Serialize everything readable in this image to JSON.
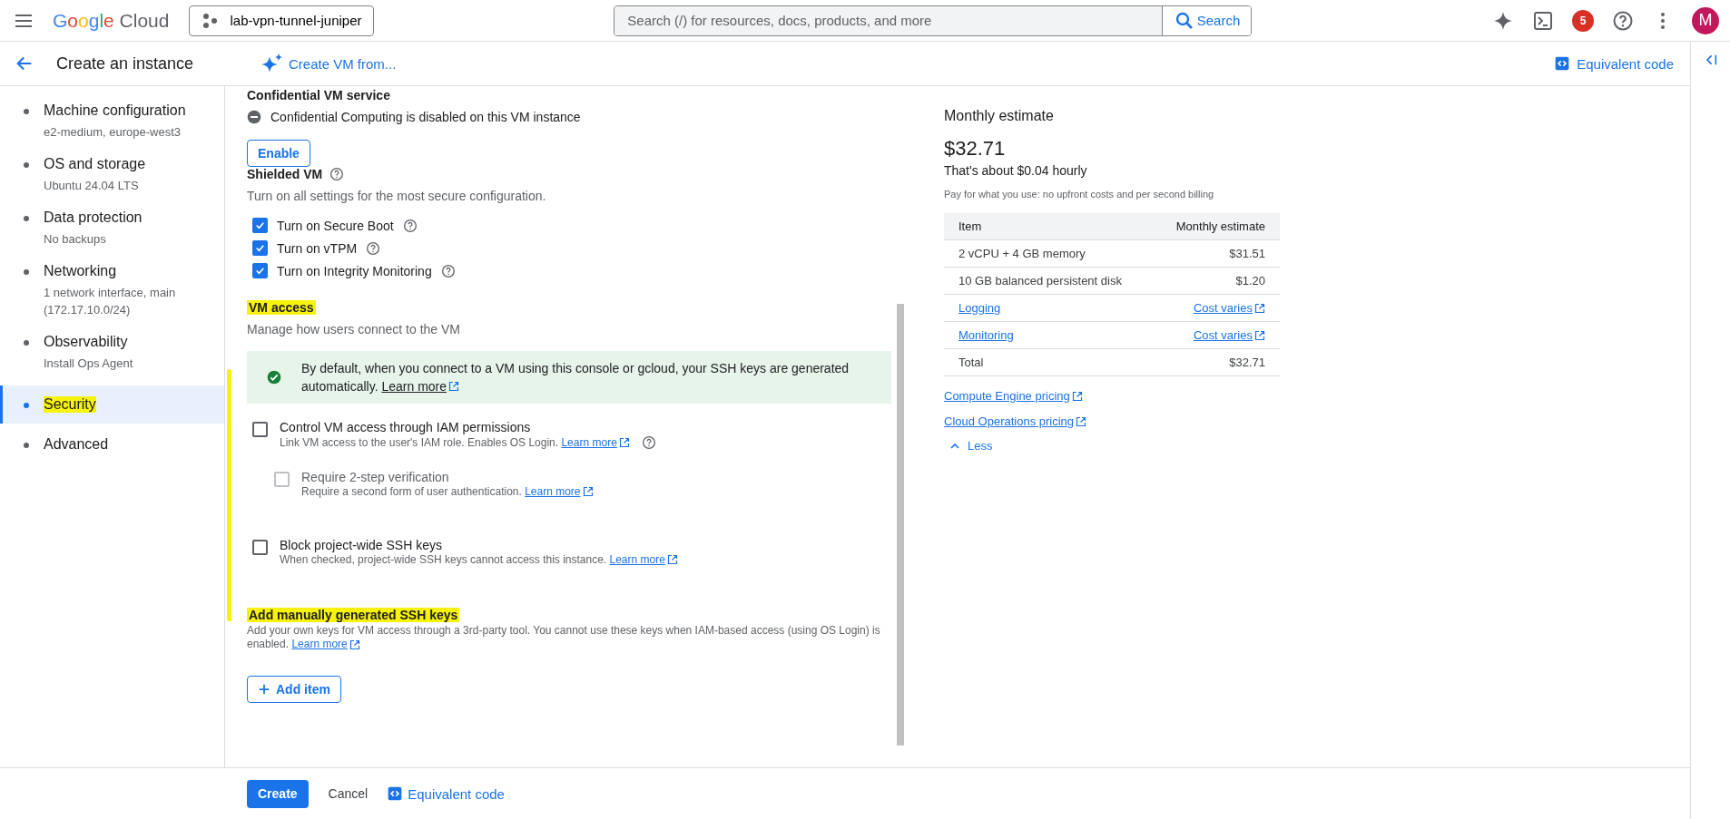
{
  "topbar": {
    "product": "Google Cloud",
    "project": "lab-vpn-tunnel-juniper",
    "search": {
      "placeholder": "Search (/) for resources, docs, products, and more",
      "button": "Search"
    },
    "notifications": "5",
    "avatar": "M"
  },
  "page_header": {
    "title": "Create an instance",
    "create_from": "Create VM from...",
    "equivalent_code": "Equivalent code"
  },
  "sidebar": {
    "items": [
      {
        "label": "Machine configuration",
        "detail": "e2-medium, europe-west3",
        "selected": false,
        "highlighted": false
      },
      {
        "label": "OS and storage",
        "detail": "Ubuntu 24.04 LTS",
        "selected": false,
        "highlighted": false
      },
      {
        "label": "Data protection",
        "detail": "No backups",
        "selected": false,
        "highlighted": false
      },
      {
        "label": "Networking",
        "detail": "1 network interface, main (172.17.10.0/24)",
        "selected": false,
        "highlighted": false
      },
      {
        "label": "Observability",
        "detail": "Install Ops Agent",
        "selected": false,
        "highlighted": false
      },
      {
        "label": "Security",
        "selected": true,
        "highlighted": true
      },
      {
        "label": "Advanced",
        "selected": false,
        "highlighted": false
      }
    ]
  },
  "form": {
    "confidential": {
      "heading": "Confidential VM service",
      "status": "Confidential Computing is disabled on this VM instance",
      "button": "Enable"
    },
    "shielded": {
      "heading": "Shielded VM",
      "description": "Turn on all settings for the most secure configuration.",
      "options": [
        {
          "label": "Turn on Secure Boot",
          "checked": true
        },
        {
          "label": "Turn on vTPM",
          "checked": true
        },
        {
          "label": "Turn on Integrity Monitoring",
          "checked": true
        }
      ]
    },
    "vm_access": {
      "heading": "VM access",
      "highlighted": true,
      "margin_stroke": true,
      "description": "Manage how users connect to the VM",
      "info": {
        "text": "By default, when you connect to a VM using this console or gcloud, your SSH keys are generated automatically.",
        "link": "Learn more"
      },
      "options": [
        {
          "label": "Control VM access through IAM permissions",
          "description": "Link VM access to the user's IAM role. Enables OS Login.",
          "link": "Learn more",
          "help": true,
          "checked": false,
          "disabled": false,
          "children": [
            {
              "label": "Require 2-step verification",
              "description": "Require a second form of user authentication.",
              "link": "Learn more",
              "help": false,
              "checked": false,
              "disabled": true
            }
          ]
        },
        {
          "label": "Block project-wide SSH keys",
          "description": "When checked, project-wide SSH keys cannot access this instance.",
          "link": "Learn more",
          "help": false,
          "checked": false,
          "disabled": false
        }
      ]
    },
    "ssh_keys": {
      "heading": "Add manually generated SSH keys",
      "highlighted": true,
      "description": "Add your own keys for VM access through a 3rd-party tool. You cannot use these keys when IAM-based access (using OS Login) is enabled.",
      "link": "Learn more",
      "button": "Add item"
    }
  },
  "estimate": {
    "heading": "Monthly estimate",
    "total": "$32.71",
    "hourly": "That's about $0.04 hourly",
    "note": "Pay for what you use: no upfront costs and per second billing",
    "table": {
      "columns": [
        "Item",
        "Monthly estimate"
      ],
      "rows": [
        {
          "kind": "plain",
          "item": "2 vCPU + 4 GB memory",
          "cost": "$31.51"
        },
        {
          "kind": "plain",
          "item": "10 GB balanced persistent disk",
          "cost": "$1.20"
        },
        {
          "kind": "link",
          "item": "Logging",
          "cost": "Cost varies"
        },
        {
          "kind": "link",
          "item": "Monitoring",
          "cost": "Cost varies"
        },
        {
          "kind": "plain",
          "item": "Total",
          "cost": "$32.71"
        }
      ]
    },
    "links": [
      "Compute Engine pricing",
      "Cloud Operations pricing"
    ],
    "toggle": "Less"
  },
  "footer": {
    "create": "Create",
    "cancel": "Cancel",
    "equivalent_code": "Equivalent code"
  }
}
